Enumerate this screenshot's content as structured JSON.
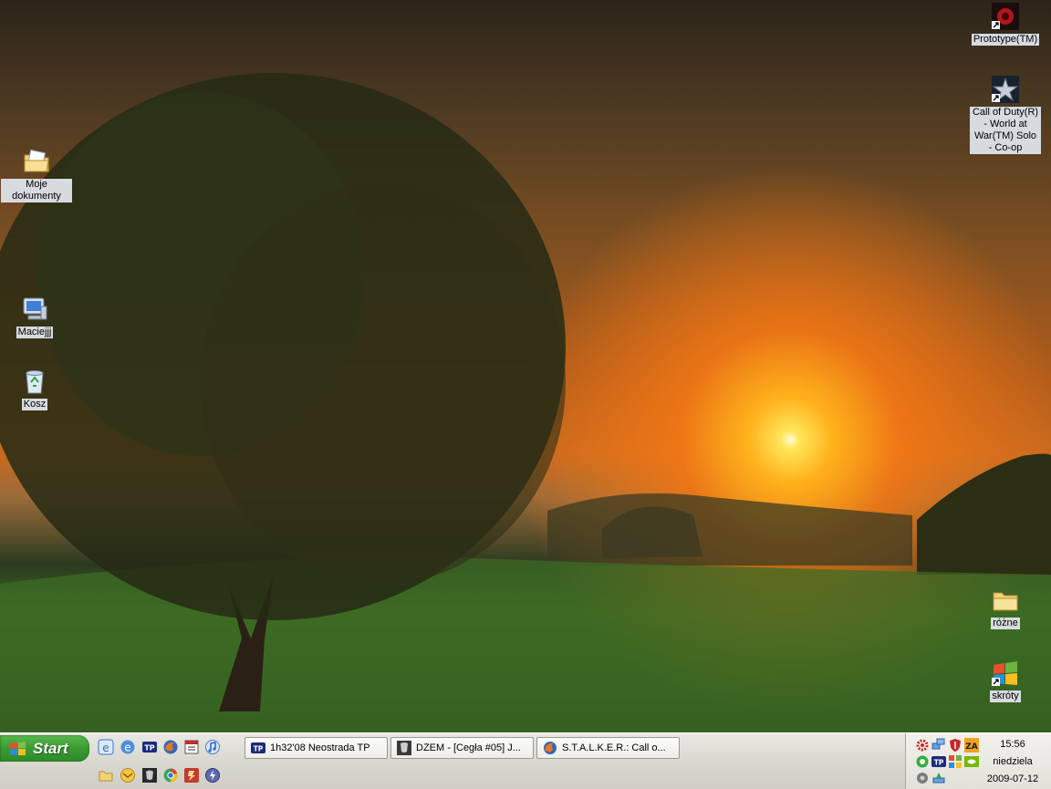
{
  "desktop": {
    "icons_left": [
      {
        "label": "Moje dokumenty",
        "icon": "my-documents-folder"
      },
      {
        "label": "Maciejjj",
        "icon": "my-computer"
      },
      {
        "label": "Kosz",
        "icon": "recycle-bin"
      }
    ],
    "icons_right": [
      {
        "label": "Prototype(TM)",
        "icon": "game-shortcut"
      },
      {
        "label": "Call of Duty(R) - World at War(TM) Solo - Co-op",
        "icon": "game-shortcut"
      },
      {
        "label": "różne",
        "icon": "folder"
      },
      {
        "label": "skróty",
        "icon": "folder-shortcut"
      }
    ]
  },
  "taskbar": {
    "start_label": "Start",
    "quick_launch": [
      "ie-icon",
      "browser-icon",
      "tp-icon",
      "firefox-icon",
      "calendar-icon",
      "itunes-icon",
      "folder-icon",
      "mail-icon",
      "stalker-icon",
      "chrome-icon",
      "opera-icon",
      "winamp-icon"
    ],
    "tasks": [
      {
        "label": "1h32'08 Neostrada TP",
        "icon": "tp-icon"
      },
      {
        "label": "DŻEM - [Cegła #05] J...",
        "icon": "winamp-icon"
      },
      {
        "label": "S.T.A.L.K.E.R.: Call o...",
        "icon": "firefox-icon"
      }
    ],
    "clock": {
      "time": "15:56",
      "day": "niedziela",
      "date": "2009-07-12"
    }
  }
}
